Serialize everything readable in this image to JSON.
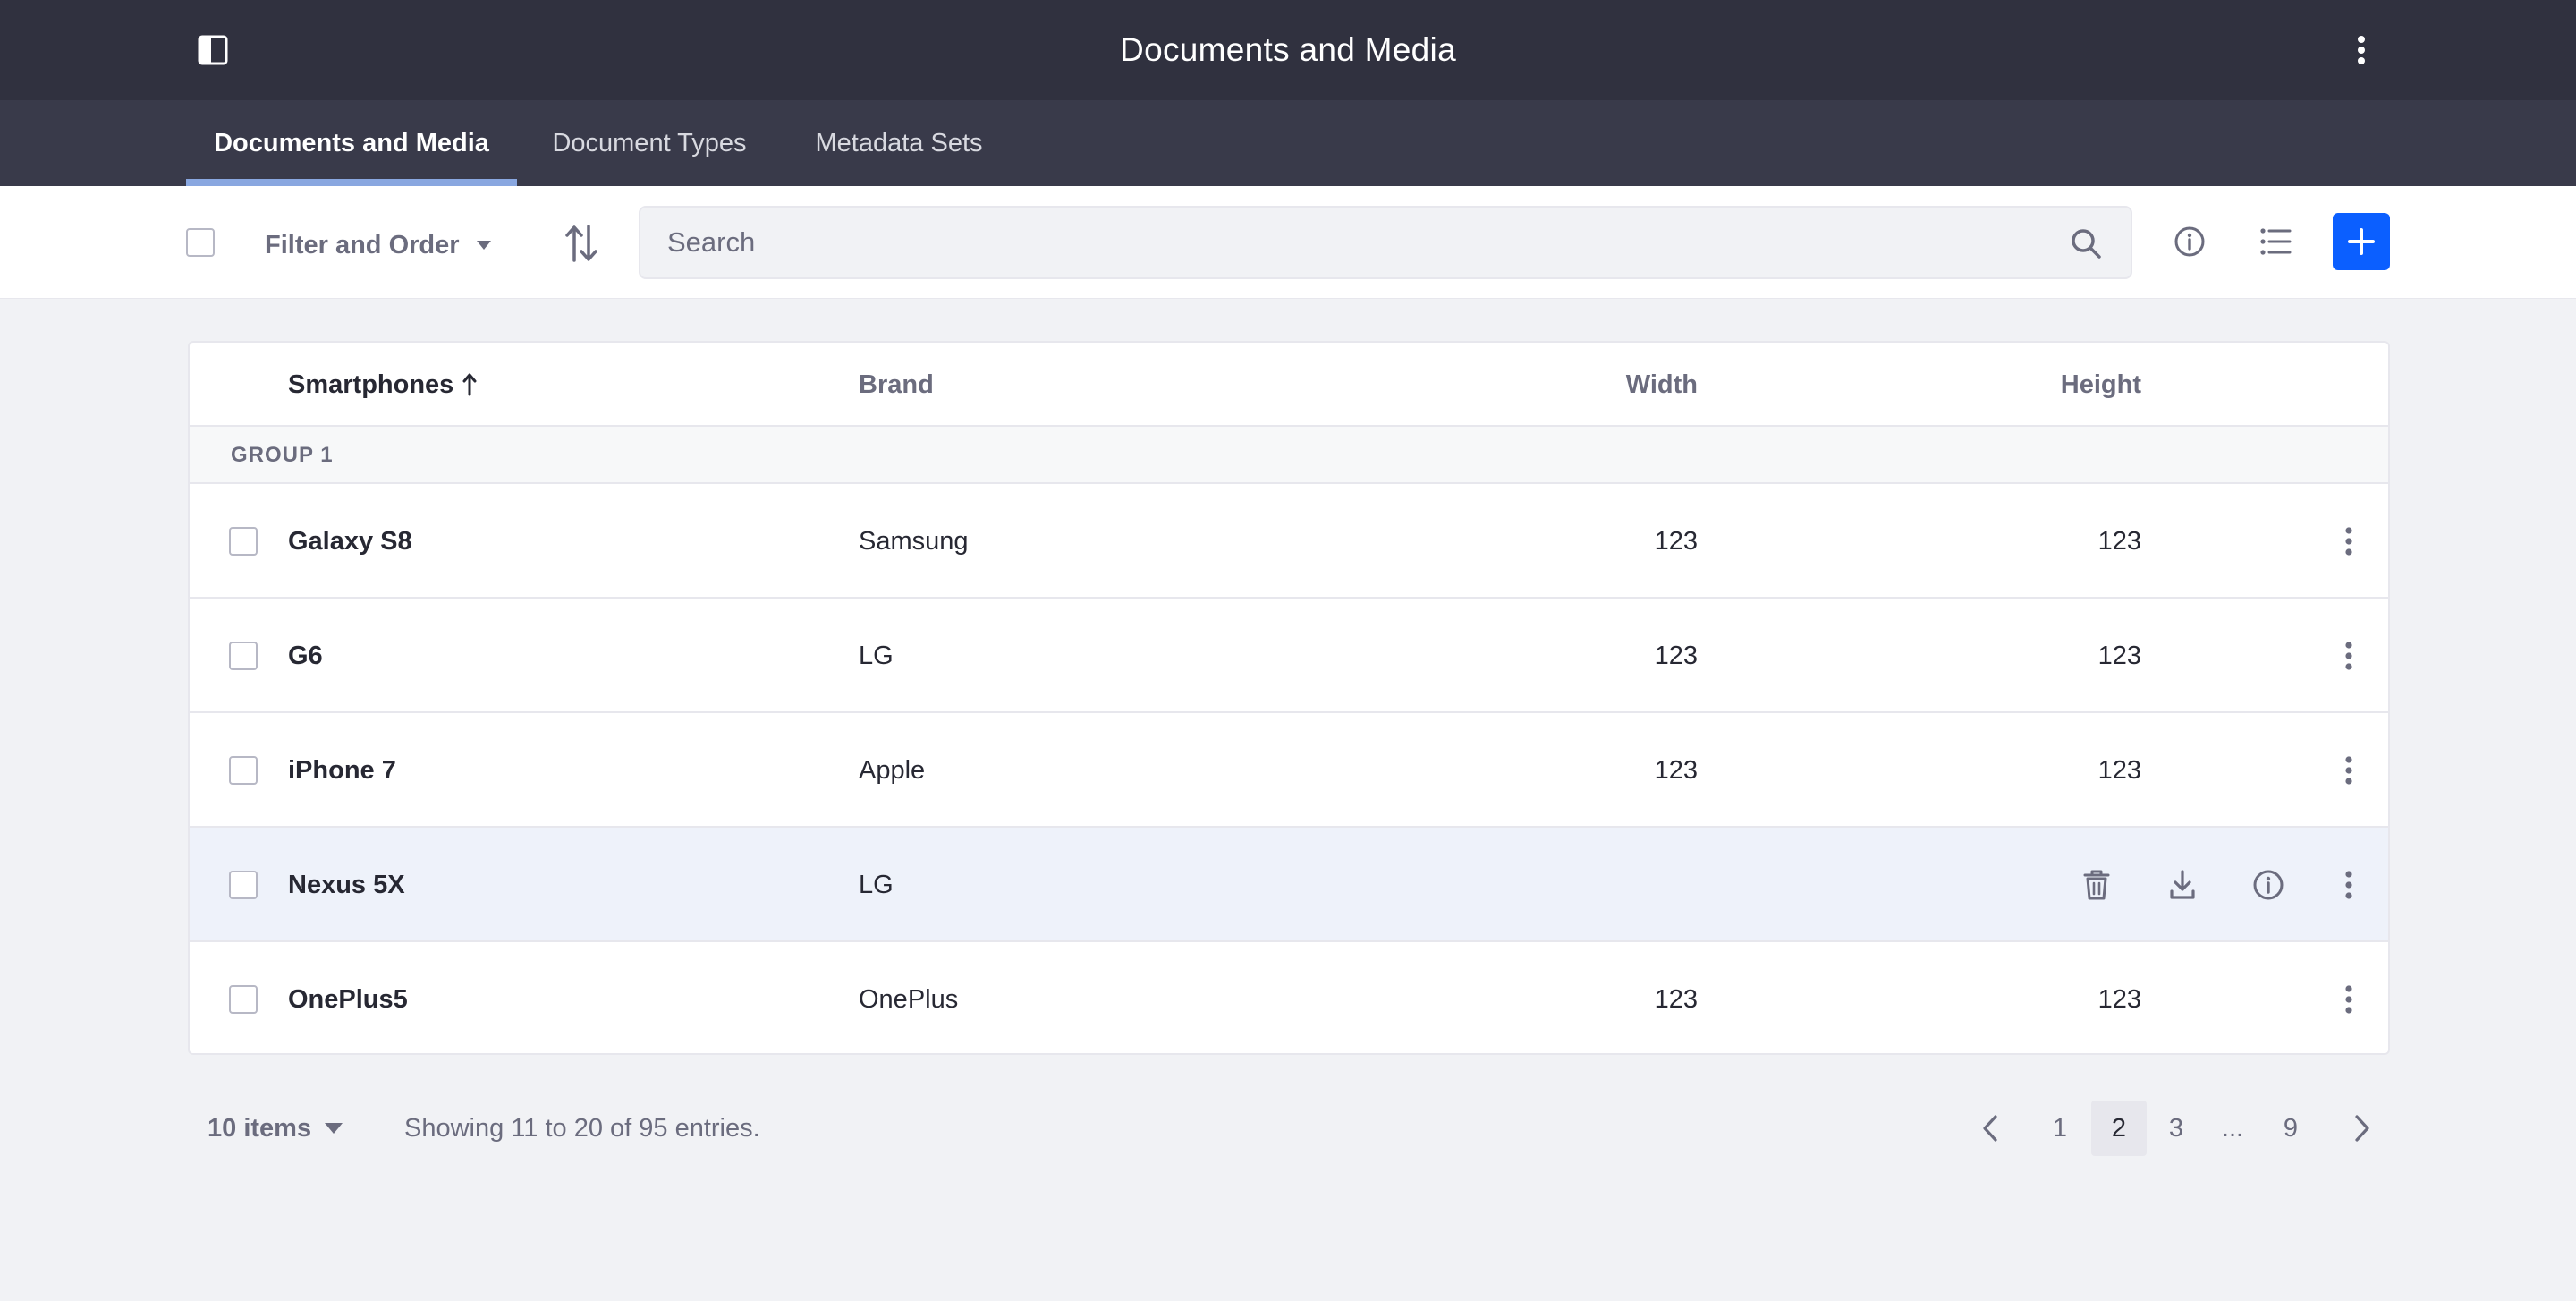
{
  "header": {
    "title": "Documents and Media",
    "sidebar_toggle_icon": "sidebar-panel-icon",
    "options_icon": "vertical-ellipsis-icon"
  },
  "nav": {
    "tabs": [
      {
        "label": "Documents and Media",
        "active": true
      },
      {
        "label": "Document Types",
        "active": false
      },
      {
        "label": "Metadata Sets",
        "active": false
      }
    ]
  },
  "toolbar": {
    "filter_label": "Filter and Order",
    "search_placeholder": "Search",
    "add_icon": "plus-icon",
    "accent_color": "#0b5fff"
  },
  "table": {
    "columns": {
      "name": "Smartphones",
      "brand": "Brand",
      "width": "Width",
      "height": "Height"
    },
    "sort_direction": "ascending",
    "group_label": "GROUP 1",
    "rows": [
      {
        "name": "Galaxy S8",
        "brand": "Samsung",
        "width": "123",
        "height": "123"
      },
      {
        "name": "G6",
        "brand": "LG",
        "width": "123",
        "height": "123"
      },
      {
        "name": "iPhone 7",
        "brand": "Apple",
        "width": "123",
        "height": "123"
      },
      {
        "name": "Nexus 5X",
        "brand": "LG",
        "width": "",
        "height": "",
        "hovered": true,
        "quick_actions": [
          "trash-icon",
          "download-icon",
          "info-icon"
        ]
      },
      {
        "name": "OnePlus5",
        "brand": "OnePlus",
        "width": "123",
        "height": "123"
      }
    ]
  },
  "footer": {
    "items_per_page": "10 items",
    "status": "Showing 11 to 20 of 95 entries.",
    "pages": [
      "1",
      "2",
      "3",
      "...",
      "9"
    ],
    "current_page": "2"
  }
}
